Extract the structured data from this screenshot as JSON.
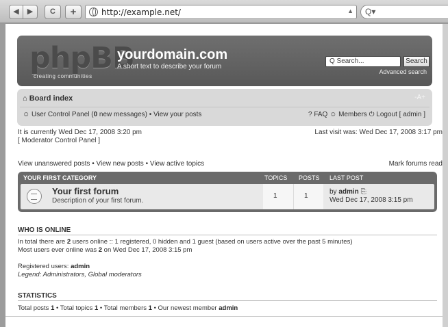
{
  "browser": {
    "back_label": "◀",
    "forward_label": "▶",
    "reload_label": "C",
    "add_label": "+",
    "url": "http://example.net/",
    "url_drop": "▲",
    "search_glyph": "Q▾"
  },
  "header": {
    "logo": "phpBB",
    "logo_tagline": "creating   communities",
    "site_name": "yourdomain.com",
    "site_description": "A short text to describe your forum",
    "search_placeholder": "Q Search...",
    "search_button": "Search",
    "advanced_search": "Advanced search"
  },
  "navbar": {
    "board_index": "Board index",
    "font_size": "-A+",
    "ucp_prefix": "User Control Panel (",
    "new_count": "0",
    "ucp_suffix": " new messages) • View your posts",
    "faq": "FAQ",
    "members": "Members",
    "logout": "Logout [ admin ]"
  },
  "info": {
    "current_time": "It is currently Wed Dec 17, 2008 3:20 pm",
    "mcp": "[ Moderator Control Panel ]",
    "last_visit": "Last visit was: Wed Dec 17, 2008 3:17 pm",
    "links": "View unanswered posts • View new posts • View active topics",
    "mark_read": "Mark forums read"
  },
  "forum_table": {
    "category": "YOUR FIRST CATEGORY",
    "col_topics": "TOPICS",
    "col_posts": "POSTS",
    "col_last_post": "LAST POST",
    "forum_name": "Your first forum",
    "forum_desc": "Description of your first forum.",
    "topics": "1",
    "posts": "1",
    "last_by": "by ",
    "last_author": "admin",
    "last_date": "Wed Dec 17, 2008 3:15 pm"
  },
  "who_is_online": {
    "title": "WHO IS ONLINE",
    "line1_a": "In total there are ",
    "line1_b": "2",
    "line1_c": " users online :: 1 registered, 0 hidden and 1 guest (based on users active over the past 5 minutes)",
    "line2_a": "Most users ever online was ",
    "line2_b": "2",
    "line2_c": " on Wed Dec 17, 2008 3:15 pm",
    "registered_label": "Registered users: ",
    "registered_user": "admin",
    "legend": "Legend: Administrators, Global moderators"
  },
  "statistics": {
    "title": "STATISTICS",
    "a": "Total posts ",
    "b": "1",
    "c": " • Total topics ",
    "d": "1",
    "e": " • Total members ",
    "f": "1",
    "g": " • Our newest member ",
    "h": "admin"
  }
}
